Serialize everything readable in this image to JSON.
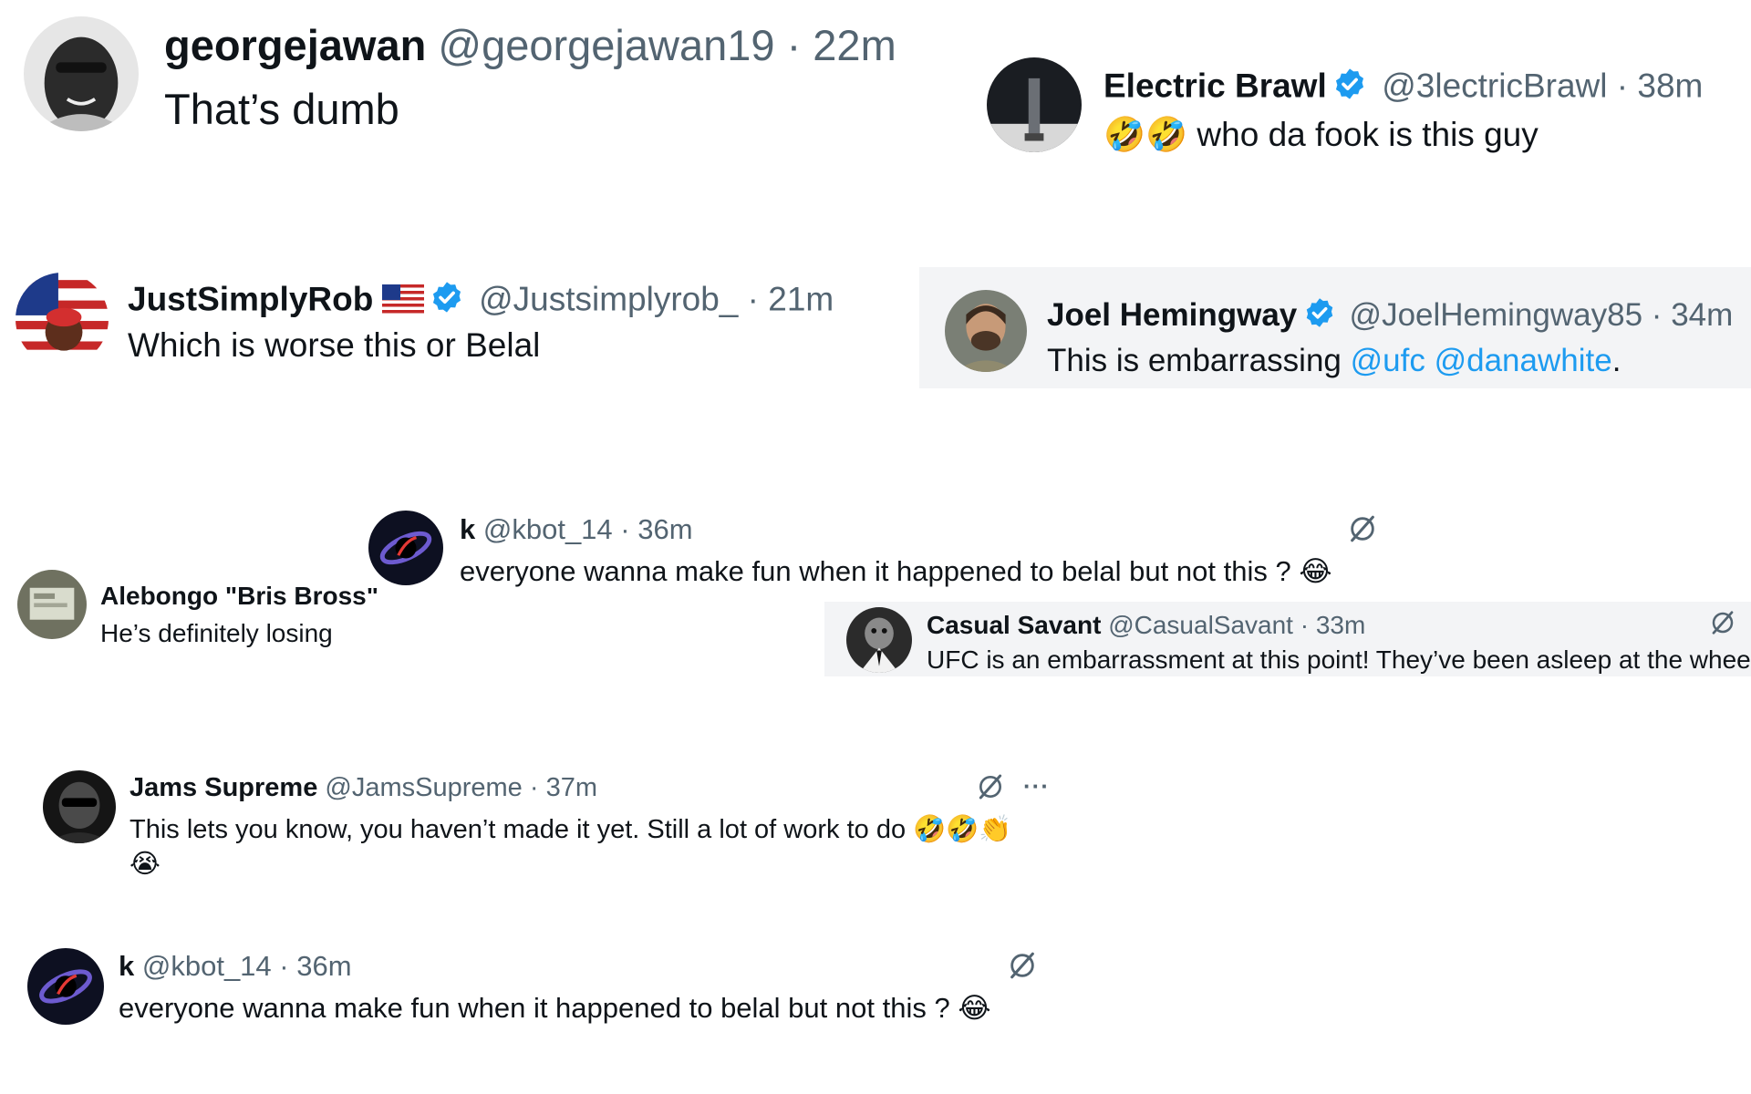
{
  "replies": {
    "r1": {
      "name": "georgejawan",
      "handle": "@georgejawan19",
      "sep": "·",
      "time": "22m",
      "text": "That’s dumb"
    },
    "r2": {
      "name": "Electric Brawl",
      "handle": "@3lectricBrawl",
      "sep": "·",
      "time": "38m",
      "emoji": "🤣🤣",
      "text": "who da fook is this guy"
    },
    "r3": {
      "name": "JustSimplyRob",
      "handle": "@Justsimplyrob_",
      "sep": "·",
      "time": "21m",
      "text": "Which is worse this or Belal"
    },
    "r4": {
      "name": "Joel Hemingway",
      "handle": "@JoelHemingway85",
      "sep": "·",
      "time": "34m",
      "text": "This is embarrassing ",
      "mention1": "@ufc",
      "mention2": "@danawhite",
      "trail": "."
    },
    "r5": {
      "name": "Alebongo \"Bris Bross\"",
      "text": "He’s definitely losing"
    },
    "r6": {
      "name": "k",
      "handle": "@kbot_14",
      "sep": "·",
      "time": "36m",
      "text": "everyone wanna make fun when it happened to belal but not this ?",
      "emoji": "😂"
    },
    "r7": {
      "name": "Casual Savant",
      "handle": "@CasualSavant",
      "sep": "·",
      "time": "33m",
      "text": "UFC is an embarrassment at this point! They’ve been asleep at the wheel"
    },
    "r8": {
      "name": "Jams Supreme",
      "handle": "@JamsSupreme",
      "sep": "·",
      "time": "37m",
      "more": "···",
      "text": "This lets you know, you haven’t made it yet. Still a lot of work to do",
      "emoji": "🤣🤣👏",
      "emoji2": "😭"
    },
    "r9": {
      "name": "k",
      "handle": "@kbot_14",
      "sep": "·",
      "time": "36m",
      "text": "everyone wanna make fun when it happened to belal but not this ?",
      "emoji": "😂"
    }
  },
  "icons": [
    "verified-badge-icon",
    "us-flag-icon",
    "grok-icon",
    "more-icon"
  ],
  "colors": {
    "link": "#1d9bf0",
    "verified": "#1d9bf0",
    "muted": "#536471",
    "text": "#0f1419",
    "card_bg": "#f3f4f6"
  }
}
